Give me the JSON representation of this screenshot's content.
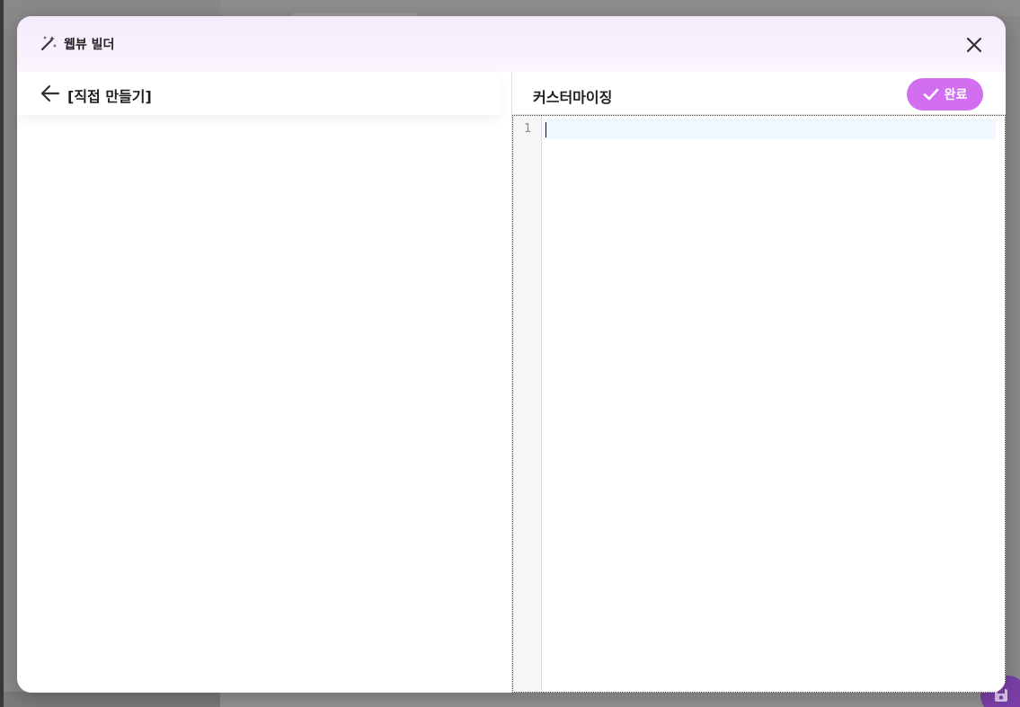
{
  "modal": {
    "title": "웹뷰 빌더",
    "header_icon": "magic-wand-icon",
    "close_icon": "close-icon"
  },
  "left_pane": {
    "back_icon": "arrow-left-icon",
    "title": "[직접 만들기]"
  },
  "right_pane": {
    "title": "커스터마이징",
    "done_button": {
      "label": "완료",
      "icon": "check-icon"
    },
    "editor": {
      "line_numbers": [
        "1"
      ],
      "content": ""
    }
  },
  "colors": {
    "accent": "#d16ff0",
    "header_bg": "#f4eafc",
    "fab_bg": "#7b3fa8"
  }
}
